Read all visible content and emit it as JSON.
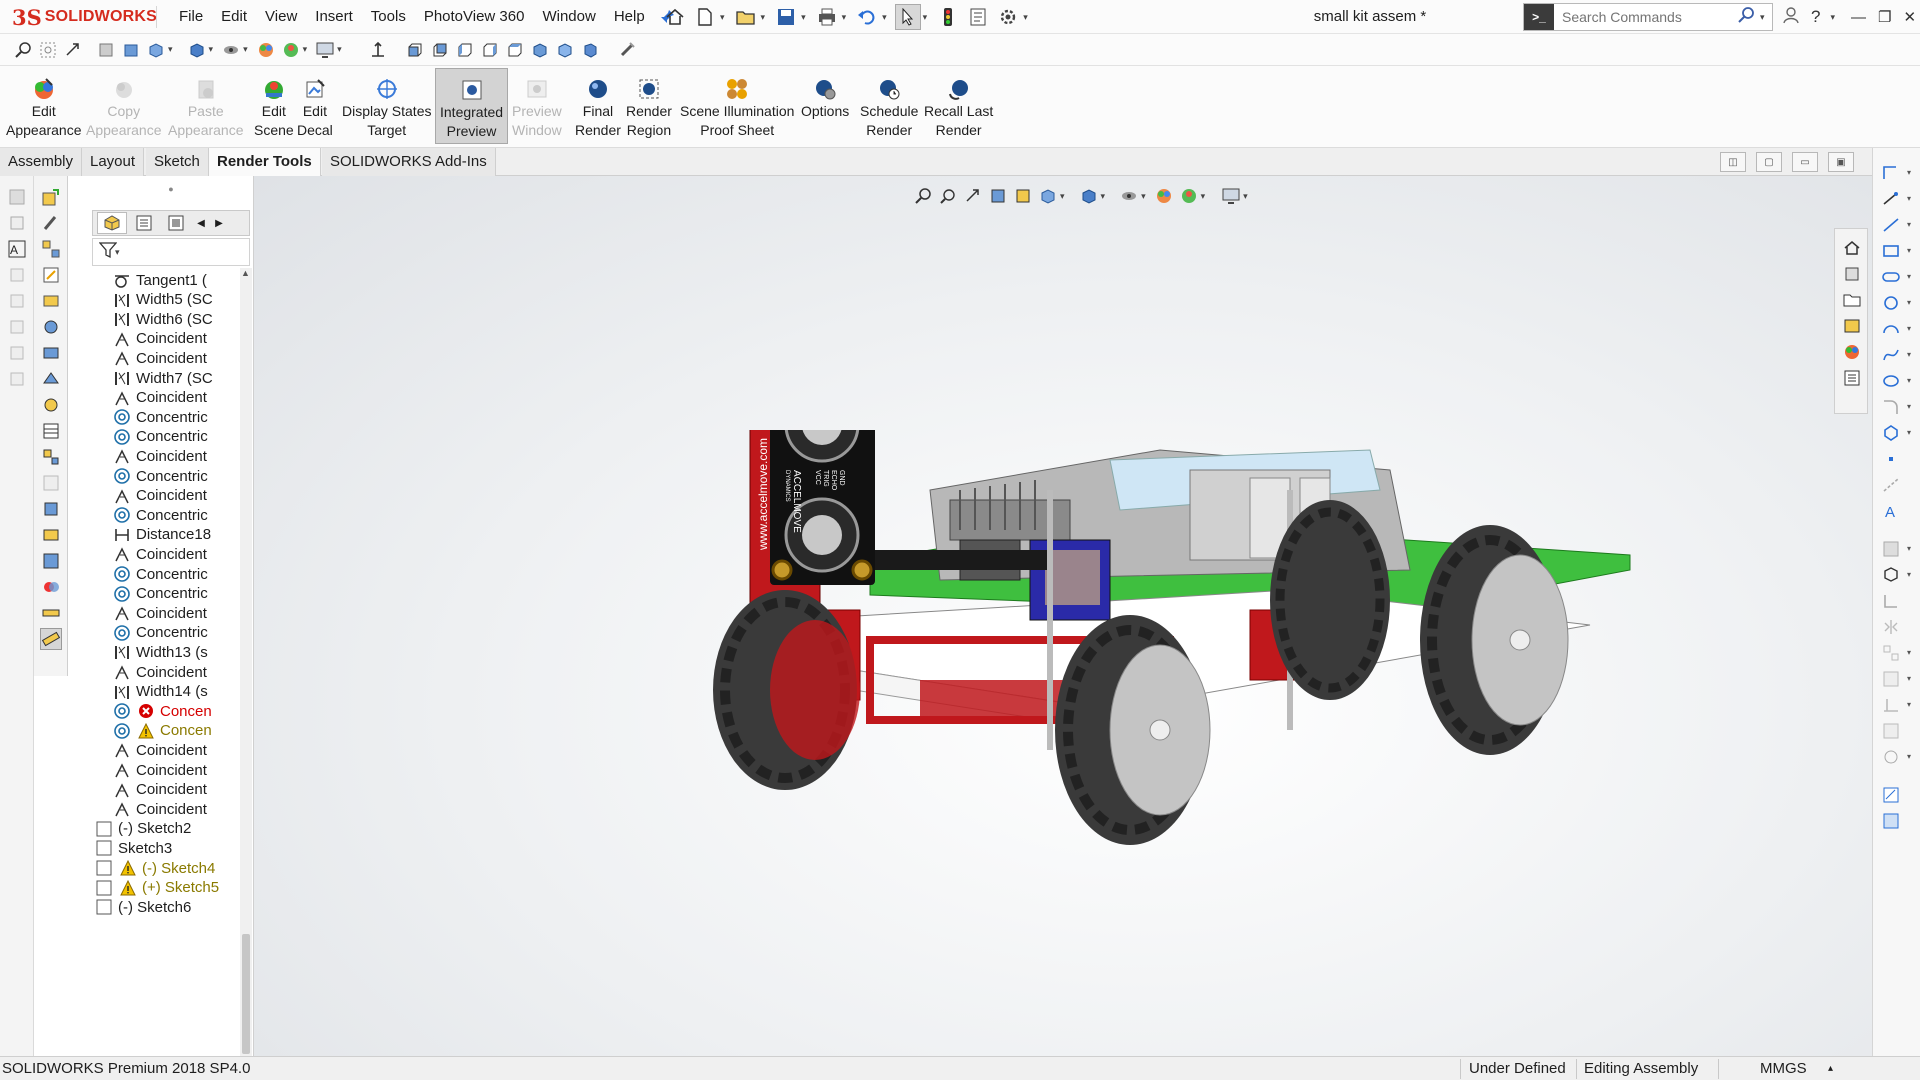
{
  "app": {
    "logo_ds": "3S",
    "logo_text": "SOLIDWORKS",
    "document_title": "small kit assem *",
    "menu": [
      "File",
      "Edit",
      "View",
      "Insert",
      "Tools",
      "PhotoView 360",
      "Window",
      "Help"
    ]
  },
  "search": {
    "placeholder": "Search Commands"
  },
  "command_manager": {
    "buttons": [
      {
        "label1": "Edit",
        "label2": "Appearance",
        "enabled": true
      },
      {
        "label1": "Copy",
        "label2": "Appearance",
        "enabled": false
      },
      {
        "label1": "Paste",
        "label2": "Appearance",
        "enabled": false
      },
      {
        "label1": "Edit",
        "label2": "Scene",
        "enabled": true
      },
      {
        "label1": "Edit",
        "label2": "Decal",
        "enabled": true
      },
      {
        "label1": "Display States",
        "label2": "Target",
        "enabled": true
      },
      {
        "label1": "Integrated",
        "label2": "Preview",
        "enabled": true,
        "pressed": true
      },
      {
        "label1": "Preview",
        "label2": "Window",
        "enabled": false
      },
      {
        "label1": "Final",
        "label2": "Render",
        "enabled": true
      },
      {
        "label1": "Render",
        "label2": "Region",
        "enabled": true
      },
      {
        "label1": "Scene Illumination",
        "label2": "Proof Sheet",
        "enabled": true
      },
      {
        "label1": "Options",
        "label2": "",
        "enabled": true
      },
      {
        "label1": "Schedule",
        "label2": "Render",
        "enabled": true
      },
      {
        "label1": "Recall Last",
        "label2": "Render",
        "enabled": true
      }
    ]
  },
  "tabs": [
    {
      "label": "Assembly",
      "active": false
    },
    {
      "label": "Layout",
      "active": false
    },
    {
      "label": "Sketch",
      "active": false
    },
    {
      "label": "Render Tools",
      "active": true
    },
    {
      "label": "SOLIDWORKS Add-Ins",
      "active": false
    }
  ],
  "feature_tree": {
    "items": [
      {
        "label": "Tangent1 (",
        "icon": "tangent-mate-icon",
        "indent": 1,
        "state": "normal"
      },
      {
        "label": "Width5 (SC",
        "icon": "width-mate-icon",
        "indent": 1,
        "state": "normal"
      },
      {
        "label": "Width6 (SC",
        "icon": "width-mate-icon",
        "indent": 1,
        "state": "normal"
      },
      {
        "label": "Coincident",
        "icon": "coincident-mate-icon",
        "indent": 1,
        "state": "normal"
      },
      {
        "label": "Coincident",
        "icon": "coincident-mate-icon",
        "indent": 1,
        "state": "normal"
      },
      {
        "label": "Width7 (SC",
        "icon": "width-mate-icon",
        "indent": 1,
        "state": "normal"
      },
      {
        "label": "Coincident",
        "icon": "coincident-mate-icon",
        "indent": 1,
        "state": "normal"
      },
      {
        "label": "Concentric",
        "icon": "concentric-mate-icon",
        "indent": 1,
        "state": "normal"
      },
      {
        "label": "Concentric",
        "icon": "concentric-mate-icon",
        "indent": 1,
        "state": "normal"
      },
      {
        "label": "Coincident",
        "icon": "coincident-mate-icon",
        "indent": 1,
        "state": "normal"
      },
      {
        "label": "Concentric",
        "icon": "concentric-mate-icon",
        "indent": 1,
        "state": "normal"
      },
      {
        "label": "Coincident",
        "icon": "coincident-mate-icon",
        "indent": 1,
        "state": "normal"
      },
      {
        "label": "Concentric",
        "icon": "concentric-mate-icon",
        "indent": 1,
        "state": "normal"
      },
      {
        "label": "Distance18",
        "icon": "distance-mate-icon",
        "indent": 1,
        "state": "normal"
      },
      {
        "label": "Coincident",
        "icon": "coincident-mate-icon",
        "indent": 1,
        "state": "normal"
      },
      {
        "label": "Concentric",
        "icon": "concentric-mate-icon",
        "indent": 1,
        "state": "normal"
      },
      {
        "label": "Concentric",
        "icon": "concentric-mate-icon",
        "indent": 1,
        "state": "normal"
      },
      {
        "label": "Coincident",
        "icon": "coincident-mate-icon",
        "indent": 1,
        "state": "normal"
      },
      {
        "label": "Concentric",
        "icon": "concentric-mate-icon",
        "indent": 1,
        "state": "normal"
      },
      {
        "label": "Width13 (s",
        "icon": "width-mate-icon",
        "indent": 1,
        "state": "normal"
      },
      {
        "label": "Coincident",
        "icon": "coincident-mate-icon",
        "indent": 1,
        "state": "normal"
      },
      {
        "label": "Width14 (s",
        "icon": "width-mate-icon",
        "indent": 1,
        "state": "normal"
      },
      {
        "label": "Concen",
        "icon": "concentric-mate-icon",
        "indent": 1,
        "state": "error"
      },
      {
        "label": "Concen",
        "icon": "concentric-mate-icon",
        "indent": 1,
        "state": "warning"
      },
      {
        "label": "Coincident",
        "icon": "coincident-mate-icon",
        "indent": 1,
        "state": "normal"
      },
      {
        "label": "Coincident",
        "icon": "coincident-mate-icon",
        "indent": 1,
        "state": "normal"
      },
      {
        "label": "Coincident",
        "icon": "coincident-mate-icon",
        "indent": 1,
        "state": "normal"
      },
      {
        "label": "Coincident",
        "icon": "coincident-mate-icon",
        "indent": 1,
        "state": "normal"
      },
      {
        "label": "(-) Sketch2",
        "icon": "sketch-icon",
        "indent": 0,
        "state": "normal"
      },
      {
        "label": "Sketch3",
        "icon": "sketch-icon",
        "indent": 0,
        "state": "normal"
      },
      {
        "label": "(-) Sketch4",
        "icon": "sketch-icon",
        "indent": 0,
        "state": "warning"
      },
      {
        "label": "(+) Sketch5",
        "icon": "sketch-icon",
        "indent": 0,
        "state": "warning"
      },
      {
        "label": "(-) Sketch6",
        "icon": "sketch-icon",
        "indent": 0,
        "state": "normal"
      }
    ]
  },
  "model": {
    "sensor_brand": "ACCELMOVE",
    "sensor_sub": "DYNAMICS",
    "sensor_url": "www.accelmove.com",
    "sensor_pins": [
      "GND",
      "ECHO",
      "TRIG",
      "VCC"
    ]
  },
  "status": {
    "product": "SOLIDWORKS Premium 2018 SP4.0",
    "definition": "Under Defined",
    "mode": "Editing Assembly",
    "units": "MMGS"
  },
  "colors": {
    "brand_red": "#d52b1e",
    "error": "#d50000",
    "warning": "#e0b000",
    "pcb_green": "#3fbf3f",
    "chassis_red": "#c0181c"
  }
}
